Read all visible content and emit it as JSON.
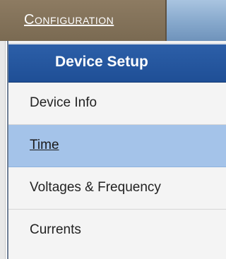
{
  "nav": {
    "configuration_label": "Configuration"
  },
  "menu": {
    "header": "Device Setup",
    "items": [
      {
        "label": "Device Info",
        "selected": false
      },
      {
        "label": "Time",
        "selected": true
      },
      {
        "label": "Voltages & Frequency",
        "selected": false
      },
      {
        "label": "Currents",
        "selected": false
      }
    ]
  },
  "colors": {
    "tab_brown": "#7a6a52",
    "header_blue": "#1f4f96",
    "highlight_blue": "#a4c3e9"
  }
}
